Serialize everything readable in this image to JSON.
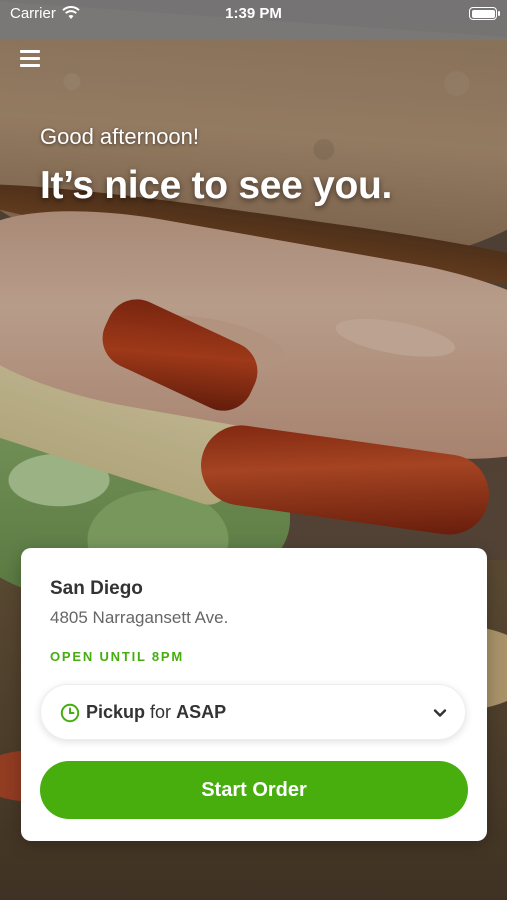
{
  "status_bar": {
    "carrier": "Carrier",
    "time": "1:39 PM"
  },
  "header": {
    "menu_icon": "hamburger-menu-icon",
    "greeting": "Good afternoon!",
    "headline": "It’s nice to see you."
  },
  "location_card": {
    "name": "San Diego",
    "address": "4805 Narragansett Ave.",
    "hours": "OPEN UNTIL 8PM",
    "order_mode": {
      "icon": "clock-icon",
      "mode": "Pickup",
      "connector": "for",
      "time": "ASAP"
    },
    "start_button": "Start Order"
  },
  "colors": {
    "accent_green": "#47ae0e",
    "card_bg": "#ffffff"
  }
}
